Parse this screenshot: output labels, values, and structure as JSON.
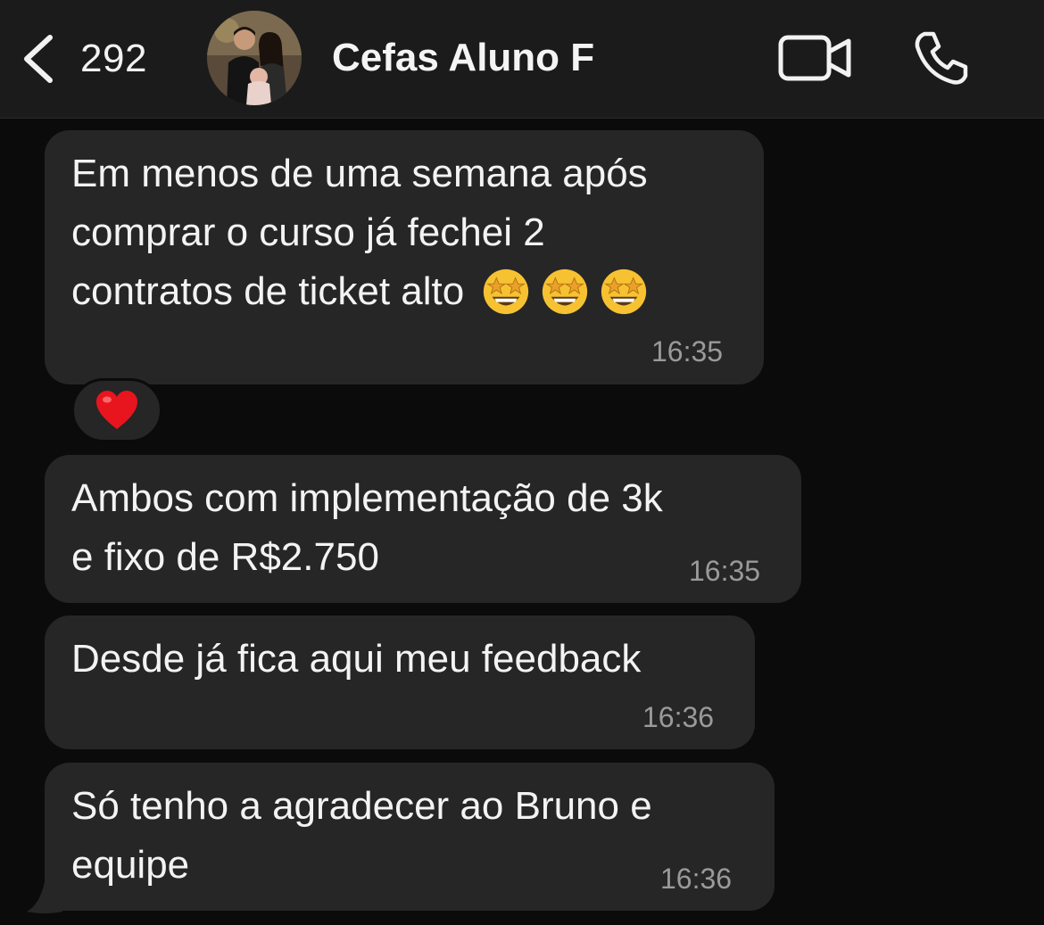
{
  "header": {
    "back_count": "292",
    "contact_name": "Cefas Aluno F"
  },
  "messages": [
    {
      "lines": [
        "Em menos de uma semana após",
        "comprar o curso já fechei 2",
        "contratos de ticket alto"
      ],
      "emoji": "star-struck",
      "time": "16:35"
    },
    {
      "lines": [
        "Ambos com implementação de 3k",
        "e fixo de R$2.750"
      ],
      "time": "16:35"
    },
    {
      "lines": [
        "Desde já fica aqui meu feedback"
      ],
      "time": "16:36"
    },
    {
      "lines": [
        "Só tenho a agradecer ao Bruno e",
        "equipe"
      ],
      "time": "16:36"
    }
  ],
  "reaction": {
    "emoji": "red-heart"
  },
  "colors": {
    "background": "#0b0b0b",
    "header": "#1b1b1b",
    "bubble": "#262626",
    "text": "#f3f3f3",
    "timestamp": "#9a9a9a"
  }
}
